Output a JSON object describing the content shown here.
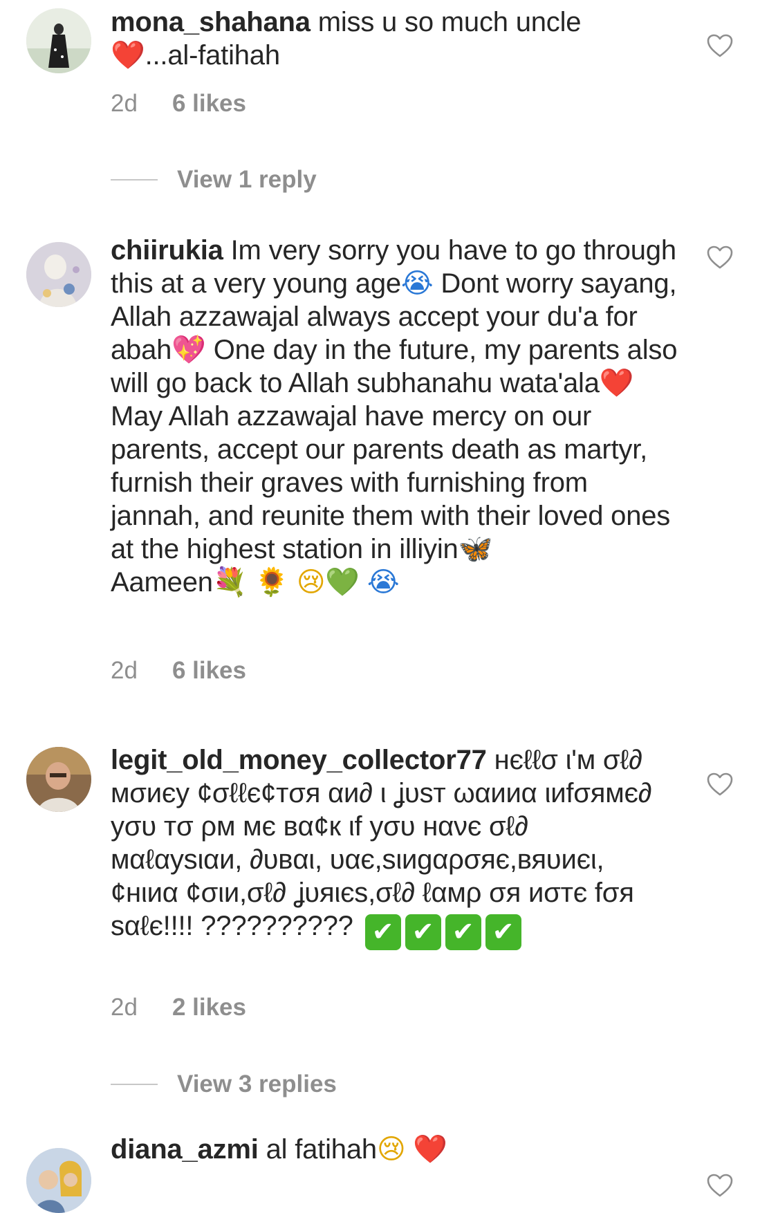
{
  "comments": [
    {
      "username": "mona_shahana",
      "text_1": "miss u so much uncle",
      "emoji_1": "❤️",
      "text_2": "...al-fatihah",
      "time": "2d",
      "likes": "6 likes",
      "replies": "View 1 reply"
    },
    {
      "username": "chiirukia",
      "text_1": "Im very sorry you have to go through this at a very young age",
      "emoji_1": "😭",
      "text_2": " Dont worry sayang, Allah azzawajal always accept your du'a for abah",
      "emoji_2": "💖",
      "text_3": " One day in the future, my parents also will go back to Allah subhanahu wata'ala",
      "emoji_3": "❤️",
      "text_4": " May Allah azzawajal have mercy on our parents, accept our parents death as martyr, furnish their graves with furnishing from jannah, and reunite them with their loved ones at the highest station in illiyin",
      "emoji_4": "🦋",
      "text_5": "Aameen",
      "emoji_5": "💐",
      "emoji_6": "🌻",
      "emoji_7": "😢",
      "emoji_8": "💚",
      "emoji_9": "😭",
      "time": "2d",
      "likes": "6 likes"
    },
    {
      "username": "legit_old_money_collector77",
      "text_1": "нєℓℓσ ι'м σℓ∂ мσиєу ¢σℓℓє¢тσя αи∂ ι ʝυѕт ωαииα ιиfσямє∂ уσυ тσ ρм мє вα¢к ιf уσυ нανє σℓ∂ мαℓαуѕιαи, ∂υвαι, υαє,ѕιиgαρσяє,вяυиєι,¢нιиα ¢σιи,σℓ∂ ʝυяιєѕ,σℓ∂ ℓαмρ σя иσтє fσя ѕαℓє!!!! ??????????",
      "checks": [
        "✔",
        "✔",
        "✔",
        "✔"
      ],
      "time": "2d",
      "likes": "2 likes",
      "replies": "View 3 replies"
    },
    {
      "username": "diana_azmi",
      "text_1": "al fatihah",
      "emoji_1": "😢",
      "emoji_2": "❤️"
    }
  ],
  "icons": {
    "like": "heart-outline-icon",
    "emoji_render": "unicode"
  },
  "colors": {
    "text": "#262626",
    "secondary": "#8e8e8e",
    "divider": "#c7c7c7",
    "check": "#45b52a"
  }
}
